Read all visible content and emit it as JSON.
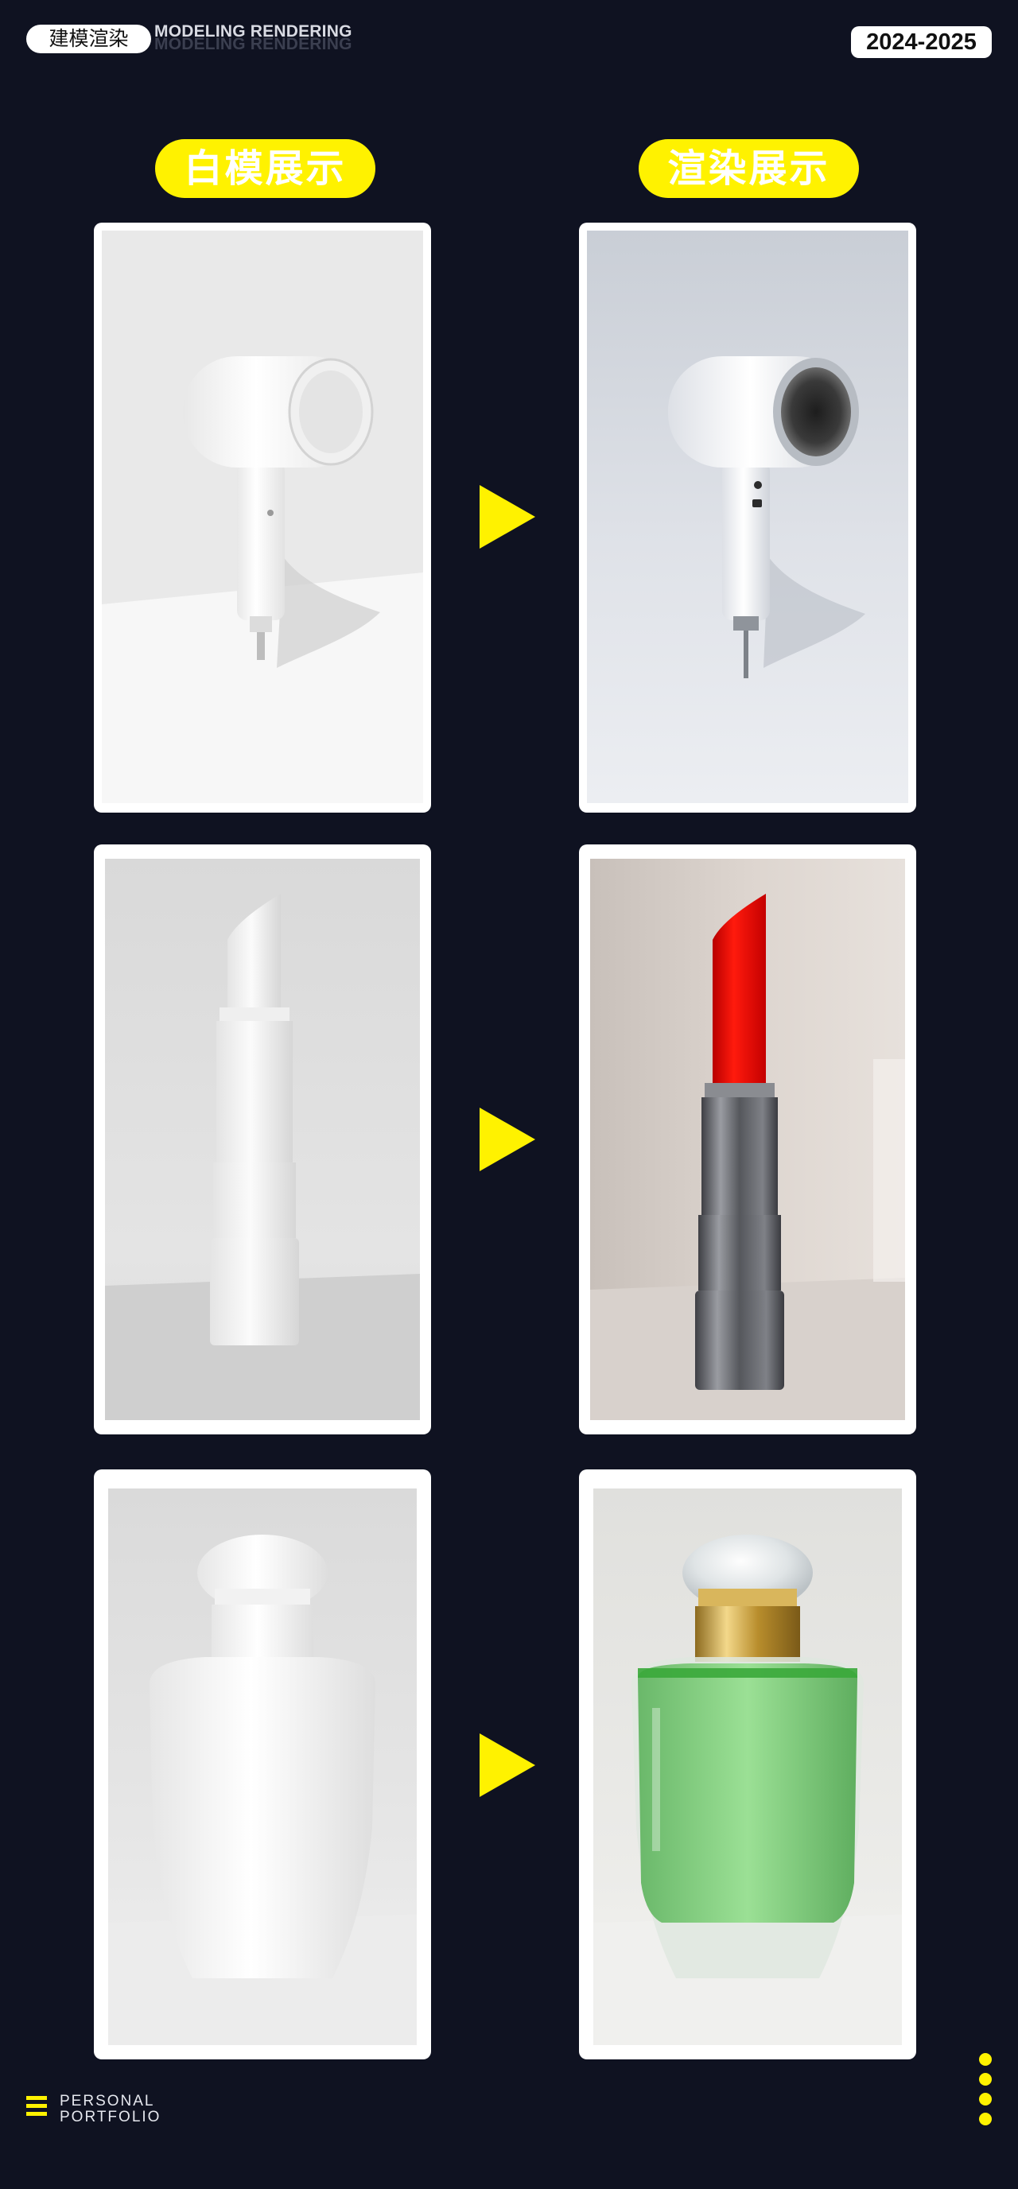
{
  "header": {
    "tag_label": "建模渲染",
    "subtitle": "MODELING RENDERING",
    "year": "2024-2025"
  },
  "columns": {
    "left_title": "白模展示",
    "right_title": "渲染展示"
  },
  "rows": [
    {
      "subject": "hair-dryer"
    },
    {
      "subject": "lipstick"
    },
    {
      "subject": "perfume-bottle"
    }
  ],
  "footer": {
    "line1": "PERSONAL",
    "line2": "PORTFOLIO"
  },
  "colors": {
    "background": "#0f1221",
    "accent": "#fff200",
    "card_border": "#ffffff"
  },
  "icons": [
    "arrow-right-icon",
    "menu-lines-icon",
    "vertical-dots-icon"
  ]
}
